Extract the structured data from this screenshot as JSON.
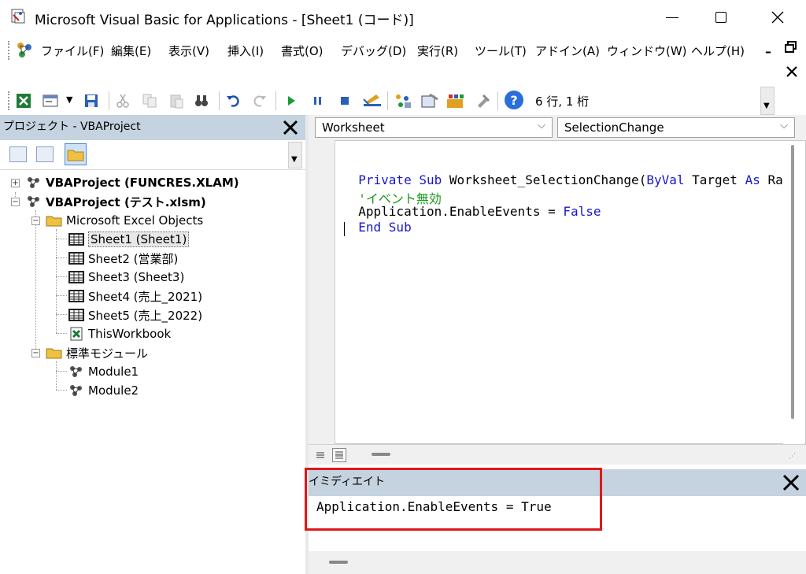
{
  "window": {
    "title": "Microsoft Visual Basic for Applications - [Sheet1 (コード)]",
    "min_icon": "minimize-icon",
    "max_icon": "maximize-icon",
    "close_icon": "close-icon"
  },
  "menu": {
    "items": [
      "ファイル(F)",
      "編集(E)",
      "表示(V)",
      "挿入(I)",
      "書式(O)",
      "デバッグ(D)",
      "実行(R)",
      "ツール(T)",
      "アドイン(A)",
      "ウィンドウ(W)",
      "ヘルプ(H)"
    ]
  },
  "toolbar": {
    "status": "6 行, 1 桁"
  },
  "project": {
    "title": "プロジェクト - VBAProject",
    "tree": [
      {
        "label": "VBAProject (FUNCRES.XLAM)",
        "bold": true
      },
      {
        "label": "VBAProject (テスト.xlsm)",
        "bold": true
      },
      {
        "label": "Microsoft Excel Objects"
      },
      {
        "label": "Sheet1 (Sheet1)"
      },
      {
        "label": "Sheet2 (営業部)"
      },
      {
        "label": "Sheet3 (Sheet3)"
      },
      {
        "label": "Sheet4 (売上_2021)"
      },
      {
        "label": "Sheet5 (売上_2022)"
      },
      {
        "label": "ThisWorkbook"
      },
      {
        "label": "標準モジュール"
      },
      {
        "label": "Module1"
      },
      {
        "label": "Module2"
      }
    ]
  },
  "code": {
    "object_combo": "Worksheet",
    "proc_combo": "SelectionChange",
    "line1_kw1": "Private Sub",
    "line1_mid": " Worksheet_SelectionChange(",
    "line1_kw2": "ByVal",
    "line1_mid2": " Target ",
    "line1_kw3": "As",
    "line1_end": " Ra",
    "line2_comment": "'イベント無効",
    "line3_text": "Application.EnableEvents = ",
    "line3_kw": "False",
    "line4_kw": "End Sub"
  },
  "immediate": {
    "title": "イミディエイト",
    "text": "Application.EnableEvents = True"
  },
  "colors": {
    "keyword": "#1818c8",
    "comment": "#1a9a1a",
    "highlight_box": "#e01818",
    "pane_header": "#c5d2df"
  }
}
